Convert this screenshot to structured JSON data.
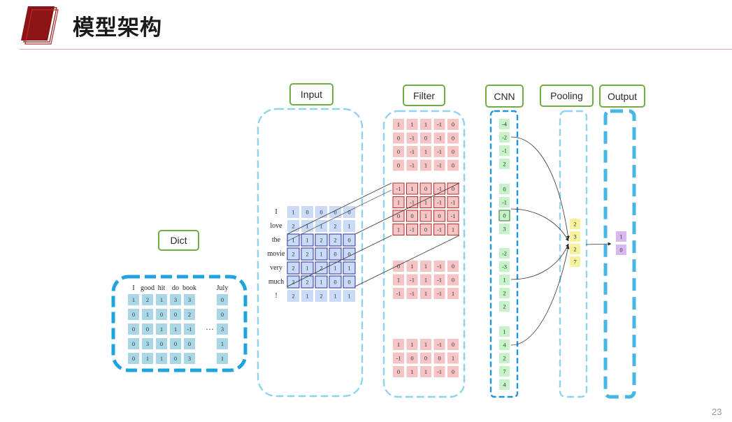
{
  "title": "模型架构",
  "page_number": "23",
  "colors": {
    "accent_red": "#a01b1b",
    "label_border": "#6fae43",
    "dict_border": "#1fa3de",
    "dashed_border": "#8fd3ef",
    "output_border": "#45b6e5",
    "dict_cell": "#a9d7e5",
    "input_cell": "#c9dbf6",
    "filter_cell": "#f5c5c5",
    "cnn_cell": "#c8f2c8",
    "pool_cell": "#f7f29c",
    "output_cell": "#d8b8ef"
  },
  "labels": {
    "dict": "Dict",
    "input": "Input",
    "filter": "Filter",
    "cnn": "CNN",
    "pooling": "Pooling",
    "output": "Output"
  },
  "dict": {
    "headers": [
      "I",
      "good",
      "hit",
      "do",
      "book",
      "July"
    ],
    "ellipsis": "···",
    "rows": [
      [
        "1",
        "2",
        "1",
        "3",
        "3",
        "0"
      ],
      [
        "0",
        "1",
        "0",
        "0",
        "2",
        "0"
      ],
      [
        "0",
        "0",
        "1",
        "1",
        "-1",
        "3"
      ],
      [
        "0",
        "3",
        "0",
        "0",
        "0",
        "1"
      ],
      [
        "0",
        "1",
        "1",
        "0",
        "3",
        "1"
      ]
    ]
  },
  "input": {
    "words": [
      "I",
      "love",
      "the",
      "movie",
      "very",
      "much",
      "!"
    ],
    "rows": [
      [
        "1",
        "0",
        "0",
        "0",
        "0"
      ],
      [
        "2",
        "1",
        "1",
        "2",
        "1"
      ],
      [
        "1",
        "1",
        "2",
        "2",
        "0"
      ],
      [
        "2",
        "2",
        "1",
        "0",
        "0"
      ],
      [
        "2",
        "1",
        "2",
        "1",
        "1"
      ],
      [
        "2",
        "2",
        "1",
        "0",
        "0"
      ],
      [
        "2",
        "1",
        "2",
        "1",
        "1"
      ]
    ]
  },
  "filters": [
    [
      [
        "1",
        "1",
        "1",
        "-1",
        "0"
      ],
      [
        "0",
        "-1",
        "0",
        "-1",
        "0"
      ],
      [
        "0",
        "-1",
        "1",
        "-1",
        "0"
      ],
      [
        "0",
        "-1",
        "1",
        "-1",
        "0"
      ]
    ],
    [
      [
        "-1",
        "1",
        "0",
        "-1",
        "0"
      ],
      [
        "1",
        "-1",
        "1",
        "-1",
        "-1"
      ],
      [
        "0",
        "0",
        "1",
        "0",
        "-1"
      ],
      [
        "1",
        "-1",
        "0",
        "-1",
        "1"
      ]
    ],
    [
      [
        "0",
        "1",
        "1",
        "-1",
        "0"
      ],
      [
        "1",
        "-1",
        "1",
        "-1",
        "0"
      ],
      [
        "-1",
        "-1",
        "1",
        "-1",
        "1"
      ]
    ],
    [
      [
        "1",
        "1",
        "1",
        "-1",
        "0"
      ],
      [
        "-1",
        "0",
        "0",
        "0",
        "1"
      ],
      [
        "0",
        "1",
        "1",
        "-1",
        "0"
      ]
    ]
  ],
  "cnn": [
    [
      "-4",
      "-2",
      "-1",
      "2"
    ],
    [
      "0",
      "-1",
      "0",
      "3"
    ],
    [
      "-2",
      "-3",
      "1",
      "2",
      "2"
    ],
    [
      "1",
      "4",
      "2",
      "7",
      "4"
    ]
  ],
  "pooling": [
    "2",
    "3",
    "2",
    "7"
  ],
  "output": [
    "1",
    "0"
  ]
}
